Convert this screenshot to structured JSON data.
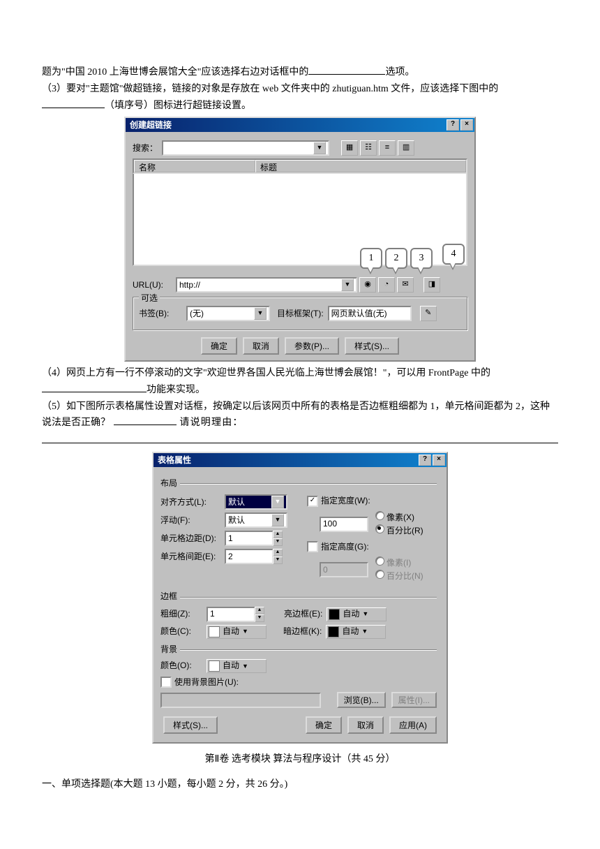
{
  "para1_pre": "题为\"中国 2010 上海世博会展馆大全\"应该选择右边对话框中的",
  "para1_post": "选项。",
  "para2_pre": "（3）要对\"主题馆\"做超链接，链接的对象是存放在 web 文件夹中的 zhutiguan.htm 文件，应该选择下图中的",
  "para2_mid": "（填序号）图标进行超链接设置。",
  "dlg1": {
    "title": "创建超链接",
    "search_label": "搜索：",
    "col_name": "名称",
    "col_title": "标题",
    "url_label": "URL(U):",
    "url_value": "http://",
    "callouts": [
      "1",
      "2",
      "3",
      "4"
    ],
    "opt_legend": "可选",
    "bookmark_label": "书签(B):",
    "bookmark_value": "(无)",
    "target_label": "目标框架(T):",
    "target_value": "网页默认值(无)",
    "ok": "确定",
    "cancel": "取消",
    "params": "参数(P)...",
    "style": "样式(S)..."
  },
  "para3_pre": "（4）网页上方有一行不停滚动的文字\"欢迎世界各国人民光临上海世博会展馆！\"，可以用 FrontPage 中的  ",
  "para3_post": "功能来实现。",
  "para4_pre": "（5）如下图所示表格属性设置对话框，按确定以后该网页中所有的表格是否边框粗细都为 1，单元格间距都为 2，这种说法是否正确？",
  "para4_post": "请说明理由：",
  "dlg2": {
    "title": "表格属性",
    "grp_layout": "布局",
    "align_label": "对齐方式(L):",
    "align_value": "默认",
    "float_label": "浮动(F):",
    "float_value": "默认",
    "cellpad_label": "单元格边距(D):",
    "cellpad_value": "1",
    "cellspace_label": "单元格间距(E):",
    "cellspace_value": "2",
    "specw": "指定宽度(W):",
    "specw_value": "100",
    "px": "像素(X)",
    "pct": "百分比(R)",
    "spech": "指定高度(G):",
    "spech_value": "0",
    "px2": "像素(I)",
    "pct2": "百分比(N)",
    "grp_border": "边框",
    "size_label": "粗细(Z):",
    "size_value": "1",
    "light_label": "亮边框(E):",
    "dark_label": "暗边框(K):",
    "color_label": "颜色(C):",
    "auto": "自动",
    "grp_bg": "背景",
    "bgcolor_label": "颜色(O):",
    "usebg": "使用背景图片(U):",
    "browse": "浏览(B)...",
    "props": "属性(I)...",
    "style": "样式(S)...",
    "ok": "确定",
    "cancel": "取消",
    "apply": "应用(A)"
  },
  "section2_title": "第Ⅱ卷 选考模块    算法与程序设计（共 45 分）",
  "section2_sub": "一、单项选择题(本大题 13 小题，每小题 2 分，共 26 分。)"
}
